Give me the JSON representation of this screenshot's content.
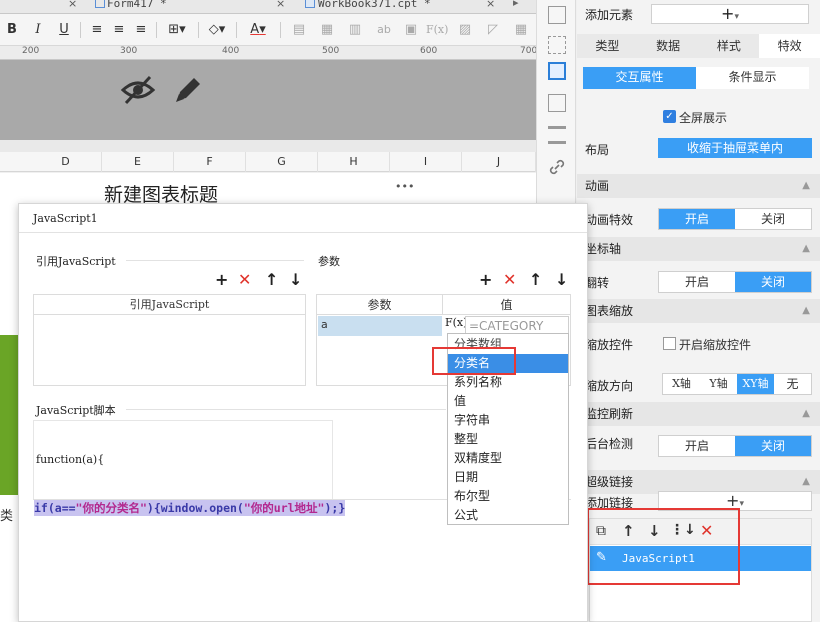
{
  "tabs": [
    {
      "label": "Form417 *"
    },
    {
      "label": "WorkBook371.cpt *"
    }
  ],
  "toolbar": {
    "bold": "B",
    "italic": "I",
    "underline": "U",
    "font_color": "A",
    "fx_label": "F(x)",
    "ab_label": "ab"
  },
  "ruler": {
    "marks": [
      "200",
      "300",
      "400",
      "500",
      "600",
      "700"
    ]
  },
  "columns": [
    "D",
    "E",
    "F",
    "G",
    "H",
    "I",
    "J"
  ],
  "sheet": {
    "chart_title": "新建图表标题",
    "more": "•••",
    "side_cell": "类"
  },
  "dialog": {
    "title": "JavaScript1",
    "ref_group": "引用JavaScript",
    "ref_header": "引用JavaScript",
    "param_group": "参数",
    "param_header_param": "参数",
    "param_header_value": "值",
    "param_row_name": "a",
    "value_fx": "F(x)",
    "value_placeholder": "=CATEGORY",
    "script_group": "JavaScript脚本",
    "script_line1": "function(a){",
    "script_line2_pre": "if(a==",
    "script_line2_str1": "\"你的分类名\"",
    "script_line2_mid": "){window.open(",
    "script_line2_str2": "\"你的url地址\"",
    "script_line2_post": ");}"
  },
  "dropdown": {
    "items": [
      "分类数组",
      "分类名",
      "系列名称",
      "值",
      "字符串",
      "整型",
      "双精度型",
      "日期",
      "布尔型",
      "公式"
    ],
    "selected": "分类名"
  },
  "right": {
    "add_element": "添加元素",
    "add_symbol": "+",
    "tabs": [
      "类型",
      "数据",
      "样式",
      "特效"
    ],
    "subtabs": [
      "交互属性",
      "条件显示"
    ],
    "fullscreen": "全屏展示",
    "layout_label": "布局",
    "layout_value": "收缩于抽屉菜单内",
    "sec_animation": "动画",
    "anim_effect": "动画特效",
    "on": "开启",
    "off": "关闭",
    "sec_axis": "坐标轴",
    "flip": "翻转",
    "sec_zoom": "图表缩放",
    "zoom_ctrl": "缩放控件",
    "zoom_enable": "开启缩放控件",
    "zoom_dir": "缩放方向",
    "dir_options": [
      "X轴",
      "Y轴",
      "XY轴",
      "无"
    ],
    "sec_monitor": "监控刷新",
    "bg_check": "后台检测",
    "sec_link": "超级链接",
    "add_link": "添加链接",
    "link_item": "JavaScript1"
  },
  "colors": {
    "accent": "#3a9ef5",
    "danger": "#e53935",
    "selected": "#3a8ee6"
  }
}
